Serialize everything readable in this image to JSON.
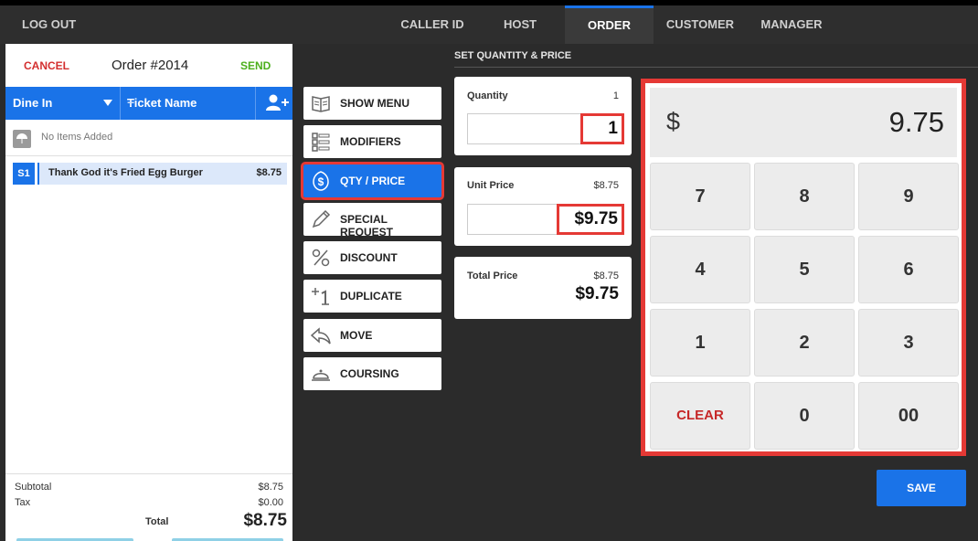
{
  "topbar": {
    "logout_label": "LOG OUT",
    "tabs": [
      {
        "label": "CALLER ID"
      },
      {
        "label": "HOST"
      },
      {
        "label": "ORDER"
      },
      {
        "label": "CUSTOMER"
      },
      {
        "label": "MANAGER"
      }
    ]
  },
  "order_panel": {
    "cancel_label": "CANCEL",
    "order_number": "Order #2014",
    "send_label": "SEND",
    "dine_in_label": "Dine In",
    "ticket_name_label": "Ticket Name",
    "ticket_plus": "+",
    "no_items_label": "No Items Added",
    "items": [
      {
        "seat": "S1",
        "name": "Thank God it's Fried Egg Burger",
        "price": "$8.75"
      }
    ],
    "totals": {
      "subtotal_label": "Subtotal",
      "subtotal": "$8.75",
      "tax_label": "Tax",
      "tax": "$0.00",
      "total_label": "Total",
      "total": "$8.75"
    }
  },
  "menu": {
    "buttons": [
      {
        "label": "SHOW MENU",
        "icon": "book-icon"
      },
      {
        "label": "MODIFIERS",
        "icon": "list-icon"
      },
      {
        "label": "QTY / PRICE",
        "icon": "dollar-icon",
        "active": true
      },
      {
        "label": "SPECIAL REQUEST",
        "icon": "pencil-icon"
      },
      {
        "label": "DISCOUNT",
        "icon": "percent-icon"
      },
      {
        "label": "DUPLICATE",
        "icon": "duplicate-icon"
      },
      {
        "label": "MOVE",
        "icon": "move-arrow-icon"
      },
      {
        "label": "COURSING",
        "icon": "cloche-icon"
      }
    ]
  },
  "qty_price": {
    "title": "SET QUANTITY & PRICE",
    "quantity_label": "Quantity",
    "quantity_current": "1",
    "quantity_value": "1",
    "unit_price_label": "Unit Price",
    "unit_price_current": "$8.75",
    "unit_price_value": "$9.75",
    "total_price_label": "Total Price",
    "total_price_old": "$8.75",
    "total_price_new": "$9.75"
  },
  "keypad": {
    "currency": "$",
    "display_value": "9.75",
    "keys": [
      "7",
      "8",
      "9",
      "4",
      "5",
      "6",
      "1",
      "2",
      "3",
      "CLEAR",
      "0",
      "00"
    ],
    "save_label": "SAVE"
  },
  "colors": {
    "accent": "#1a73e8",
    "highlight": "#e53935",
    "cancel": "#d32f2f",
    "send": "#4caf1c"
  }
}
